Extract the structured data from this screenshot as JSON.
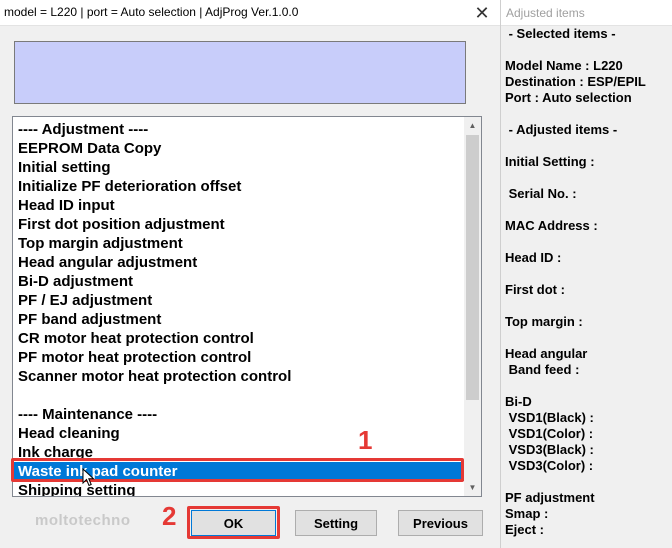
{
  "window": {
    "title": "model = L220 | port = Auto selection | AdjProg Ver.1.0.0",
    "close_glyph": "✕"
  },
  "list": {
    "items": [
      "---- Adjustment ----",
      "EEPROM Data Copy",
      "Initial setting",
      "Initialize PF deterioration offset",
      "Head ID input",
      "First dot position adjustment",
      "Top margin adjustment",
      "Head angular adjustment",
      "Bi-D adjustment",
      "PF / EJ adjustment",
      "PF band adjustment",
      "CR motor heat protection control",
      "PF motor heat protection control",
      "Scanner motor heat protection control",
      "",
      "---- Maintenance ----",
      "Head cleaning",
      "Ink charge",
      "Waste ink pad counter",
      "Shipping setting"
    ],
    "selected_index": 18
  },
  "buttons": {
    "ok": "OK",
    "setting": "Setting",
    "previous": "Previous"
  },
  "annotations": {
    "step1": "1",
    "step2": "2",
    "watermark": "moltotechno",
    "color": "#e53935"
  },
  "right_panel": {
    "title": "Adjusted items",
    "lines": [
      " - Selected items -",
      "",
      "Model Name : L220",
      "Destination : ESP/EPIL",
      "Port : Auto selection",
      "",
      " - Adjusted items -",
      "",
      "Initial Setting :",
      "",
      " Serial No. :",
      "",
      "MAC Address :",
      "",
      "Head ID :",
      "",
      "First dot :",
      "",
      "Top margin :",
      "",
      "Head angular",
      " Band feed :",
      "",
      "Bi-D",
      " VSD1(Black) :",
      " VSD1(Color) :",
      " VSD3(Black) :",
      " VSD3(Color) :",
      "",
      "PF adjustment",
      "Smap :",
      "Eject :"
    ]
  },
  "colors": {
    "selection": "#0078d7",
    "message_box": "#c8cdfa"
  }
}
